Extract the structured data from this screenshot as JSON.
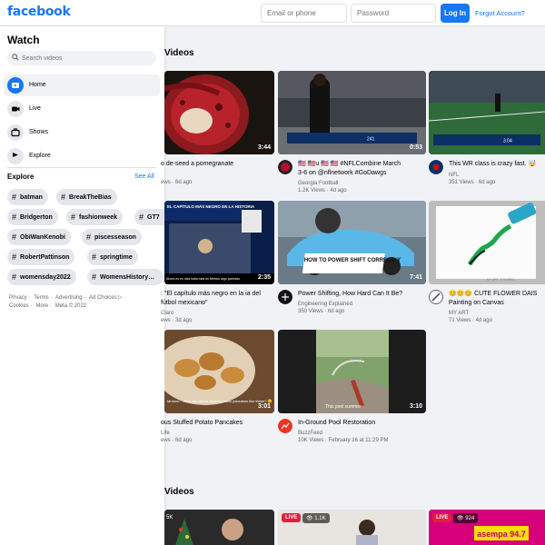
{
  "header": {
    "logo": "facebook",
    "email_placeholder": "Email or phone",
    "password_placeholder": "Password",
    "login_label": "Log In",
    "forgot_label": "Forgot Account?"
  },
  "sidebar": {
    "title": "Watch",
    "search_placeholder": "Search videos",
    "nav": [
      {
        "label": "Home",
        "icon": "home-icon"
      },
      {
        "label": "Live",
        "icon": "live-icon"
      },
      {
        "label": "Shows",
        "icon": "shows-icon"
      },
      {
        "label": "Explore",
        "icon": "explore-icon"
      }
    ],
    "explore_heading": "Explore",
    "see_all": "See All",
    "chips": [
      "batman",
      "BreakTheBias",
      "Bridgerton",
      "fashionweek",
      "GT7",
      "ObiWanKenobi",
      "piscesseason",
      "RobertPattinson",
      "springtime",
      "womensday2022",
      "WomensHistory…"
    ],
    "footer": [
      "Privacy",
      "·",
      "Terms",
      "·",
      "Advertising",
      "·",
      "Ad Choices ▷",
      "·",
      "Cookies",
      "·",
      "More",
      "·",
      "Meta © 2022"
    ]
  },
  "sections": {
    "top_title": "Videos",
    "live_title": "Videos"
  },
  "videos": [
    {
      "title": "o de-seed a pomegranate",
      "channel": "",
      "meta": "ews · 6d ago",
      "duration": "3:44"
    },
    {
      "title": "🇺🇸 🇺🇸u 🇺🇸 🇺🇸 #NFLCombine March 3-6 on @nflnetwork #GoDawgs",
      "channel": "Georgia Football",
      "meta": "1.2K Views · 4d ago",
      "duration": "0:53"
    },
    {
      "title": "This WR class is crazy fast. 🤯",
      "channel": "NFL",
      "meta": "351 Views · 6d ago",
      "duration": ""
    },
    {
      "title": ": \"El capítulo más negro en la ia del fútbol mexicano\"",
      "channel": "Claro",
      "meta": "ews · 3d ago",
      "duration": "2:35"
    },
    {
      "title": "Power Shifting, How Hard Can It Be?",
      "channel": "Engineering Explained",
      "meta": "350 Views · 6d ago",
      "duration": "7:41"
    },
    {
      "title": "😊😊😊 CUTE FLOWER DAIS Painting on Canvas",
      "channel": "MY ART",
      "meta": "71 Views · 4d ago",
      "duration": ""
    },
    {
      "title": "ous Stuffed Potato Pancakes",
      "channel": "Life",
      "meta": "ews · 6d ago",
      "duration": "3:01"
    },
    {
      "title": "In-Ground Pool Restoration",
      "channel": "BuzzFeed",
      "meta": "10K Views · February 16 at 11:29 PM",
      "duration": "3:10"
    }
  ],
  "thumb_text": {
    "fmx_headline": "EL CAPÍTULO MÁS NEGRO EN LA HISTORIA",
    "fmx_caption": "Ahora es en vida halla más en México algo parecido",
    "car_banner": "HOW TO POWER SHIFT CORRECTLY",
    "pancake_caption": "Mmmm... Who can refuse stuffed potato pancakes like these? 😋",
    "pool_caption": "This pool summer",
    "art_watermark": "MY ART CHANNEL",
    "nfl_score": "3.04",
    "uga_score": "241"
  },
  "live": [
    {
      "badge": "",
      "views": "5K"
    },
    {
      "badge": "LIVE",
      "views": "1.1K"
    },
    {
      "badge": "LIVE",
      "views": "924",
      "brand": "asempa 94.7"
    }
  ],
  "colors": {
    "brand": "#1877f2",
    "live": "#e41e3f",
    "bg": "#f0f2f5"
  }
}
